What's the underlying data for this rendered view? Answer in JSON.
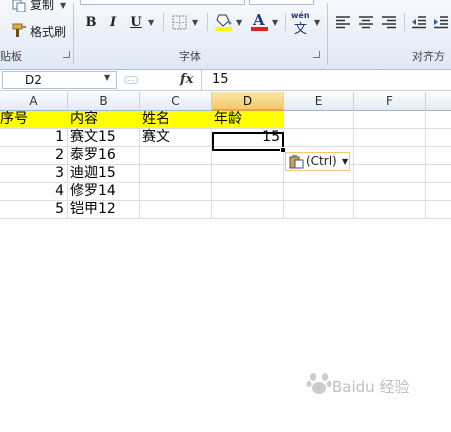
{
  "ribbon": {
    "copy_label": "复制",
    "format_painter_label": "格式刷",
    "clipboard_group": "贴板",
    "font_group": "字体",
    "align_group": "对齐方",
    "bold": "B",
    "italic": "I",
    "underline": "U",
    "font_color_glyph": "A",
    "wen_label": "wén",
    "wen_char": "文",
    "fill_color": "#ffff00",
    "font_color": "#e02020"
  },
  "formula_bar": {
    "name_box": "D2",
    "dots": "...",
    "fx": "fx",
    "value": "15"
  },
  "sheet": {
    "columns": [
      "A",
      "B",
      "C",
      "D",
      "E",
      "F"
    ],
    "selected_column": "D",
    "header_row": {
      "a": "序号",
      "b": "内容",
      "c": "姓名",
      "d": "年龄"
    },
    "rows": [
      {
        "a": "1",
        "b": "赛文15",
        "c": "赛文",
        "d": "15"
      },
      {
        "a": "2",
        "b": "泰罗16",
        "c": "",
        "d": ""
      },
      {
        "a": "3",
        "b": "迪迦15",
        "c": "",
        "d": ""
      },
      {
        "a": "4",
        "b": "修罗14",
        "c": "",
        "d": ""
      },
      {
        "a": "5",
        "b": "铠甲12",
        "c": "",
        "d": ""
      }
    ],
    "header_fill": "#ffff00",
    "paste_options_label": "(Ctrl)"
  },
  "watermark": {
    "text": "Baidu 经验"
  }
}
